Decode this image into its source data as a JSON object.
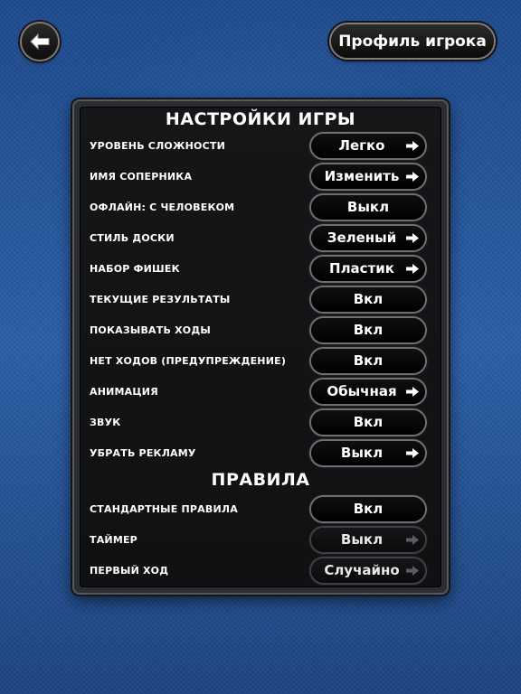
{
  "header": {
    "back_icon": "arrow-left-icon",
    "profile_label": "Профиль игрока"
  },
  "settings": {
    "title": "НАСТРОЙКИ ИГРЫ",
    "rows": [
      {
        "label": "УРОВЕНЬ СЛОЖНОСТИ",
        "value": "Легко",
        "arrow": true,
        "enabled": true
      },
      {
        "label": "ИМЯ СОПЕРНИКА",
        "value": "Изменить",
        "arrow": true,
        "enabled": true
      },
      {
        "label": "ОФЛАЙН: С ЧЕЛОВЕКОМ",
        "value": "Выкл",
        "arrow": false,
        "enabled": true
      },
      {
        "label": "СТИЛЬ ДОСКИ",
        "value": "Зеленый",
        "arrow": true,
        "enabled": true
      },
      {
        "label": "НАБОР ФИШЕК",
        "value": "Пластик",
        "arrow": true,
        "enabled": true
      },
      {
        "label": "ТЕКУЩИЕ РЕЗУЛЬТАТЫ",
        "value": "Вкл",
        "arrow": false,
        "enabled": true
      },
      {
        "label": "ПОКАЗЫВАТЬ ХОДЫ",
        "value": "Вкл",
        "arrow": false,
        "enabled": true
      },
      {
        "label": "НЕТ ХОДОВ (ПРЕДУПРЕЖДЕНИЕ)",
        "value": "Вкл",
        "arrow": false,
        "enabled": true
      },
      {
        "label": "АНИМАЦИЯ",
        "value": "Обычная",
        "arrow": true,
        "enabled": true
      },
      {
        "label": "ЗВУК",
        "value": "Вкл",
        "arrow": false,
        "enabled": true
      },
      {
        "label": "УБРАТЬ РЕКЛАМУ",
        "value": "Выкл",
        "arrow": true,
        "enabled": true
      }
    ]
  },
  "rules": {
    "title": "ПРАВИЛА",
    "rows": [
      {
        "label": "СТАНДАРТНЫЕ ПРАВИЛА",
        "value": "Вкл",
        "arrow": false,
        "enabled": true
      },
      {
        "label": "ТАЙМЕР",
        "value": "Выкл",
        "arrow": true,
        "enabled": false
      },
      {
        "label": "ПЕРВЫЙ ХОД",
        "value": "Случайно",
        "arrow": true,
        "enabled": false
      }
    ]
  },
  "colors": {
    "background": "#2a5ea6",
    "panel": "#151617",
    "text": "#ffffff"
  }
}
